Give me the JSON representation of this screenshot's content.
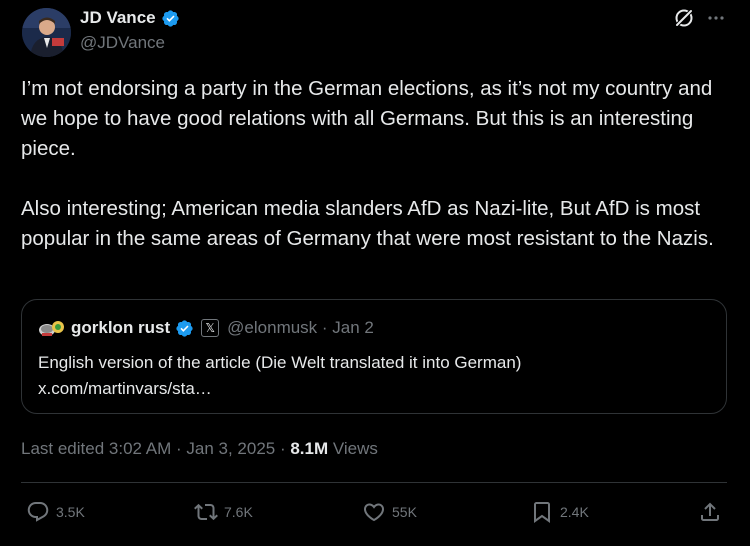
{
  "author": {
    "display_name": "JD Vance",
    "handle": "@JDVance",
    "verified": true
  },
  "tweet": {
    "paragraphs": [
      "I’m not endorsing a party in the German elections, as it’s not my country and we hope to have good relations with all Germans. But this is an interesting piece.",
      "Also interesting; American media slanders AfD as Nazi-lite, But AfD is most popular in the same areas of Germany that were most resistant to the Nazis."
    ]
  },
  "quote": {
    "display_name": "gorklon rust",
    "handle_date": "@elonmusk · Jan 2",
    "badge": "𝕏",
    "text": "English version of the article (Die Welt translated it into German)",
    "link": "x.com/martinvars/sta…"
  },
  "meta": {
    "edited": "Last edited 3:02 AM · Jan 3, 2025 · ",
    "views_count": "8.1M",
    "views_label": " Views"
  },
  "actions": {
    "replies": "3.5K",
    "reposts": "7.6K",
    "likes": "55K",
    "bookmarks": "2.4K"
  },
  "icons": {
    "verified": "verified-badge-icon",
    "grok": "grok-icon",
    "more": "more-icon",
    "reply": "reply-icon",
    "repost": "repost-icon",
    "like": "heart-icon",
    "bookmark": "bookmark-icon",
    "share": "share-icon"
  },
  "colors": {
    "background": "#000000",
    "text": "#e7e9ea",
    "secondary": "#71767b",
    "verified": "#1d9bf0",
    "border": "#2f3336"
  }
}
